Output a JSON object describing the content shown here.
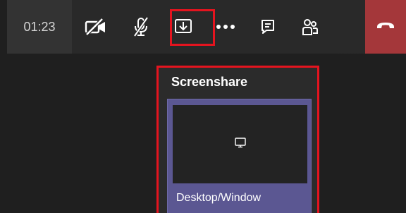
{
  "call": {
    "timer": "01:23"
  },
  "toolbar": {
    "buttons": [
      {
        "name": "camera-off",
        "icon": "video-off-icon"
      },
      {
        "name": "microphone-off",
        "icon": "mic-off-icon"
      },
      {
        "name": "share",
        "icon": "share-tray-icon",
        "highlighted": true
      },
      {
        "name": "more-actions",
        "icon": "more-icon"
      },
      {
        "name": "chat",
        "icon": "chat-icon"
      },
      {
        "name": "participants",
        "icon": "people-icon"
      },
      {
        "name": "hang-up",
        "icon": "phone-hangup-icon"
      }
    ]
  },
  "share_tray": {
    "title": "Screenshare",
    "options": [
      {
        "label": "Desktop/Window",
        "icon": "monitor-icon"
      }
    ]
  },
  "colors": {
    "toolbar_bg": "#292929",
    "timer_bg": "#333333",
    "hangup_bg": "#a4373a",
    "highlight": "#e4141f",
    "card_bg": "#5b5792",
    "page_bg": "#1f1f1f"
  }
}
